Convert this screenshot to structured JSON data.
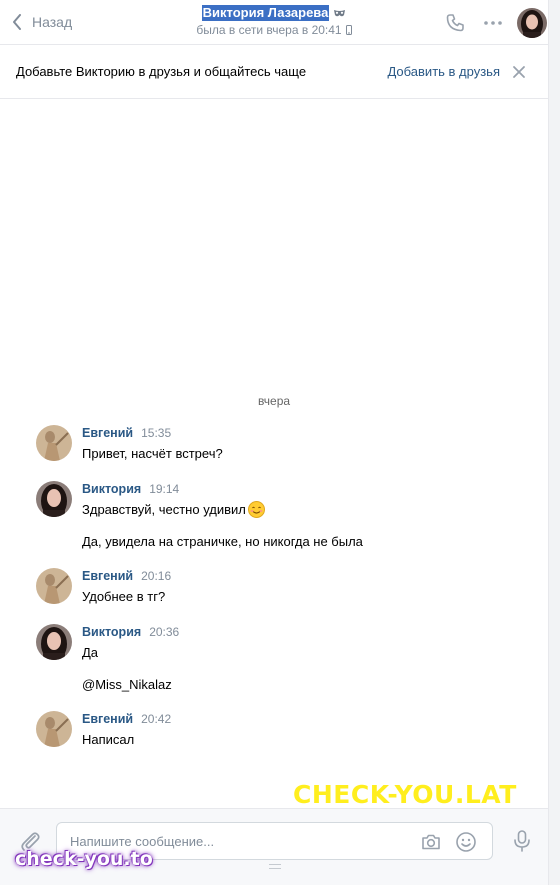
{
  "header": {
    "back_label": "Назад",
    "peer_name": "Виктория Лазарева",
    "peer_status": "была в сети вчера в 20:41"
  },
  "banner": {
    "text": "Добавьте Викторию в друзья и общайтесь чаще",
    "add_label": "Добавить в друзья"
  },
  "history": {
    "day_separator": "вчера",
    "messages": [
      {
        "author": "Евгений",
        "time": "15:35",
        "lines": [
          "Привет, насчёт встреч?"
        ]
      },
      {
        "author": "Виктория",
        "time": "19:14",
        "lines": [
          "Здравствуй, честно удивил",
          "Да, увидела на страничке, но никогда не была"
        ]
      },
      {
        "author": "Евгений",
        "time": "20:16",
        "lines": [
          "Удобнее в тг?"
        ]
      },
      {
        "author": "Виктория",
        "time": "20:36",
        "lines": [
          "Да",
          "@Miss_Nikalaz"
        ]
      },
      {
        "author": "Евгений",
        "time": "20:42",
        "lines": [
          "Написал"
        ]
      }
    ]
  },
  "composer": {
    "placeholder": "Напишите сообщение..."
  },
  "watermarks": {
    "big": "CHECK-YOU.LAT",
    "small": "check-you.to"
  },
  "colors": {
    "link": "#2a5885",
    "muted": "#818c99",
    "watermark_yellow": "#ffee1e",
    "selection": "#3b6fc4"
  }
}
